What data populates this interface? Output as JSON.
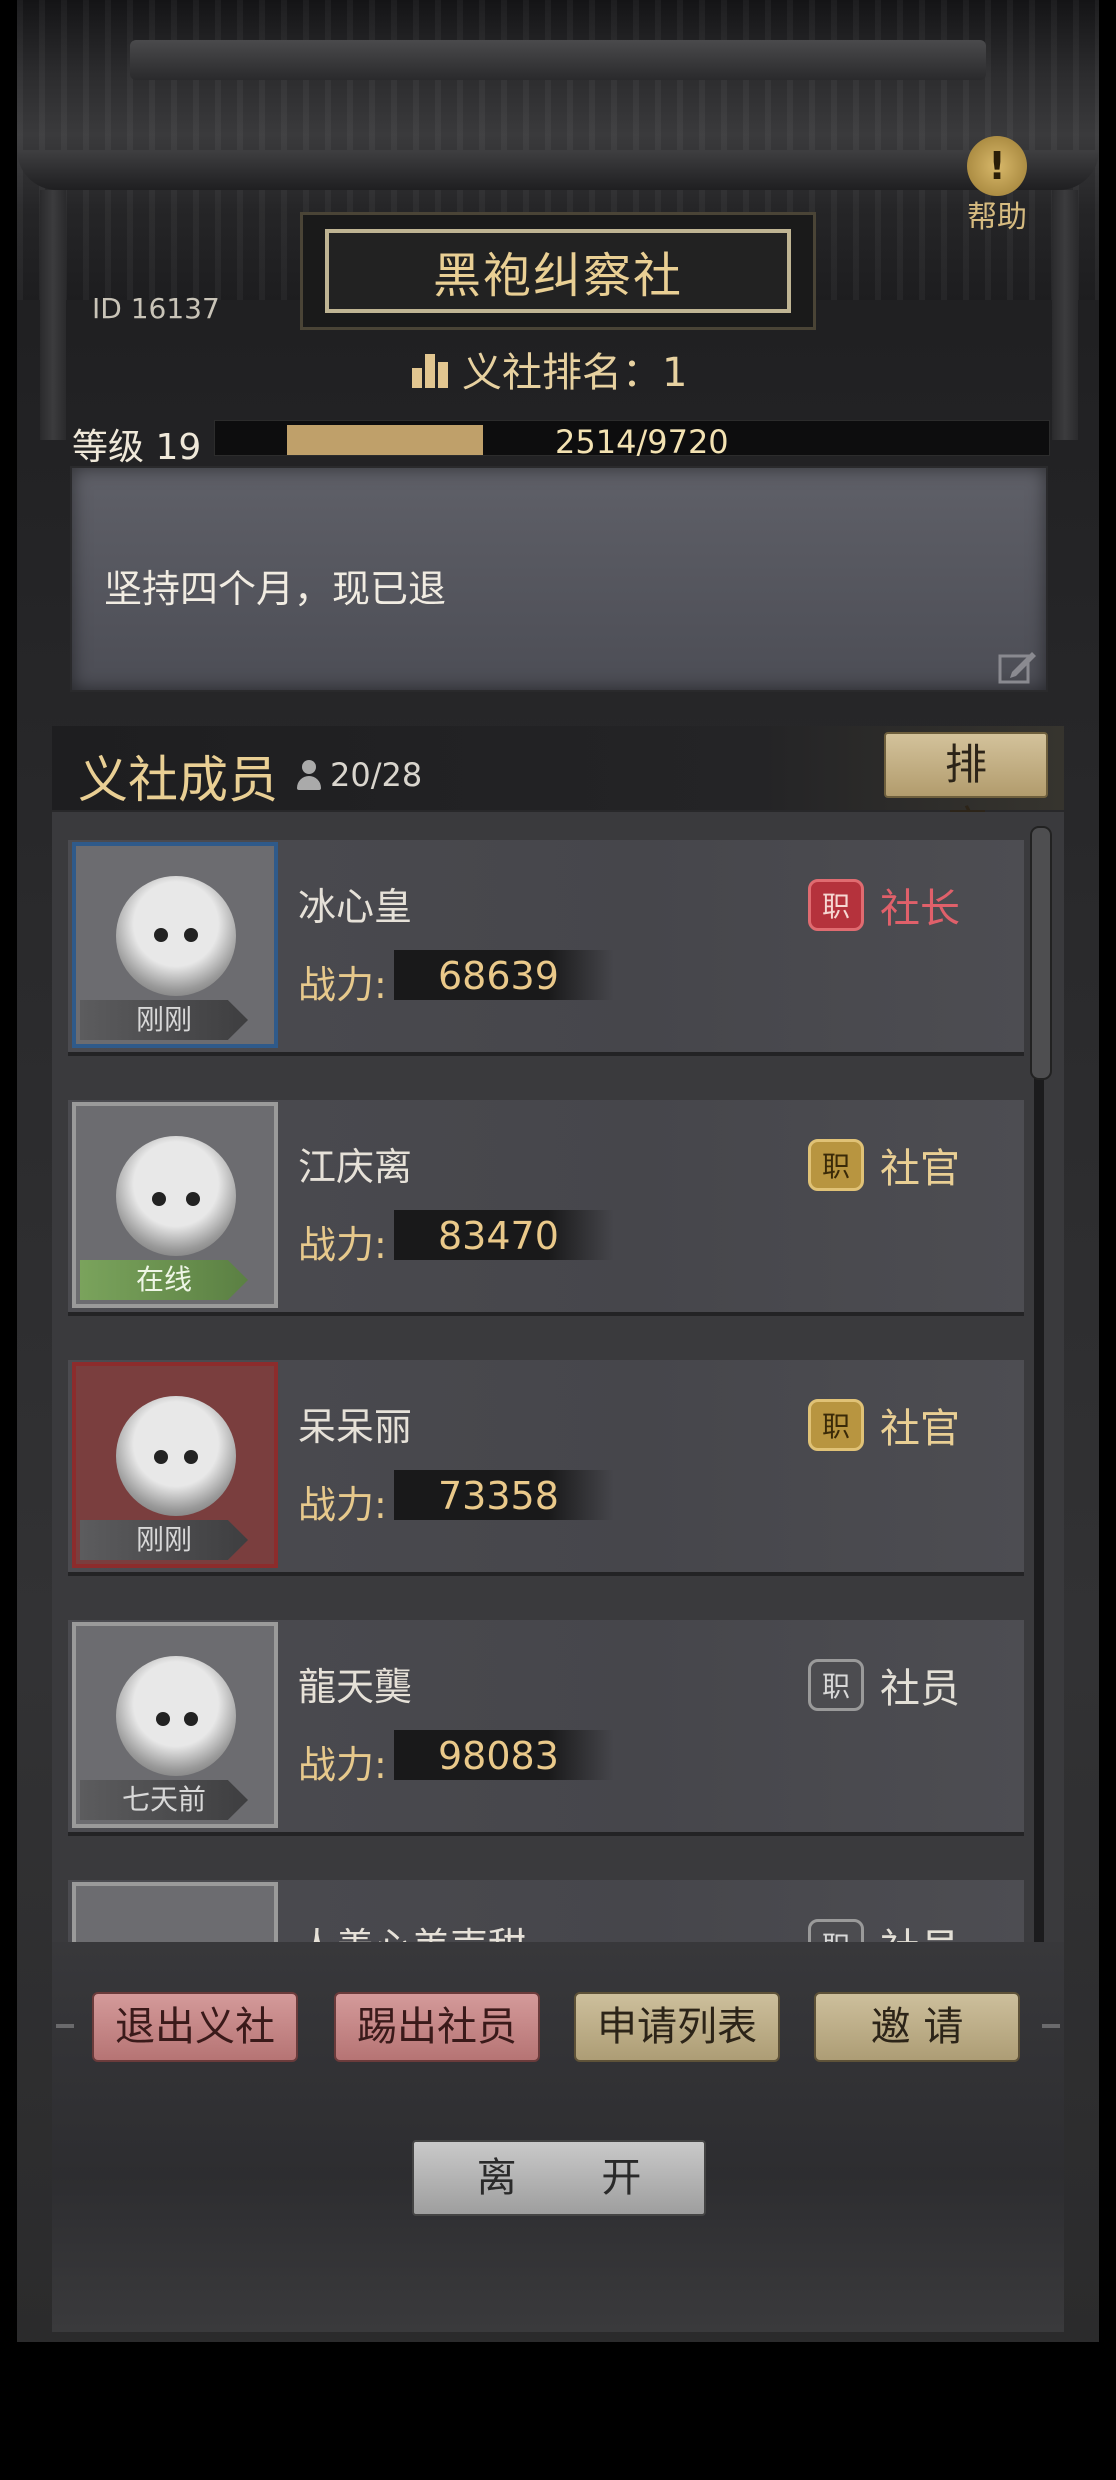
{
  "header": {
    "title": "黑袍纠察社",
    "help_label": "帮助",
    "id_text": "ID  16137",
    "rank_text": "义社排名：1"
  },
  "level": {
    "label": "等级 19",
    "progress_text": "2514/9720",
    "current": 2514,
    "max": 9720
  },
  "notice": {
    "text": "坚持四个月，现已退"
  },
  "members": {
    "title": "义社成员",
    "count": "20/28",
    "sort_label": "排 序",
    "power_label": "战力:",
    "items": [
      {
        "name": "冰心皇",
        "power": "68639",
        "status": "刚刚",
        "role_badge": "职",
        "role": "社长",
        "role_color": "#e0606a"
      },
      {
        "name": "江庆离",
        "power": "83470",
        "status": "在线",
        "role_badge": "职",
        "role": "社官",
        "role_color": "#e9cf94"
      },
      {
        "name": "呆呆丽",
        "power": "73358",
        "status": "刚刚",
        "role_badge": "职",
        "role": "社官",
        "role_color": "#e9cf94"
      },
      {
        "name": "龍天龑",
        "power": "98083",
        "status": "七天前",
        "role_badge": "职",
        "role": "社员",
        "role_color": "#e3dfd6"
      },
      {
        "name": "人善心美声甜",
        "power": "",
        "status": "",
        "role_badge": "职",
        "role": "社员",
        "role_color": "#e3dfd6"
      }
    ]
  },
  "actions": {
    "quit": "退出义社",
    "kick": "踢出社员",
    "applications": "申请列表",
    "invite": "邀 请",
    "leave": "离 开"
  }
}
